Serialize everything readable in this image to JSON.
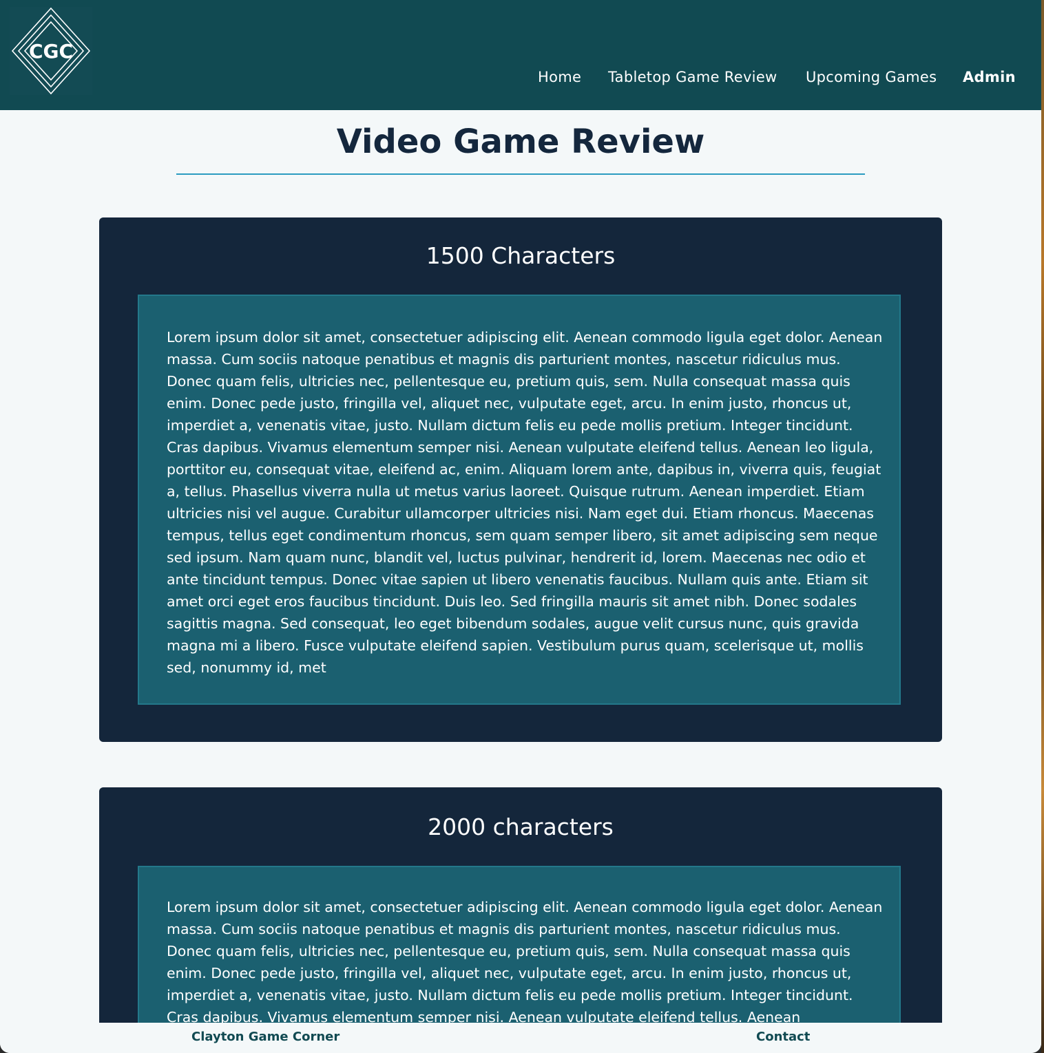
{
  "header": {
    "logo_text": "CGC",
    "nav": {
      "home": "Home",
      "tabletop": "Tabletop Game Review",
      "upcoming": "Upcoming Games",
      "admin": "Admin"
    }
  },
  "page": {
    "title": "Video Game Review"
  },
  "cards": [
    {
      "heading": "1500 Characters",
      "body": "Lorem ipsum dolor sit amet, consectetuer adipiscing elit. Aenean commodo ligula eget dolor. Aenean massa. Cum sociis natoque penatibus et magnis dis parturient montes, nascetur ridiculus mus. Donec quam felis, ultricies nec, pellentesque eu, pretium quis, sem. Nulla consequat massa quis enim. Donec pede justo, fringilla vel, aliquet nec, vulputate eget, arcu. In enim justo, rhoncus ut, imperdiet a, venenatis vitae, justo. Nullam dictum felis eu pede mollis pretium. Integer tincidunt. Cras dapibus. Vivamus elementum semper nisi. Aenean vulputate eleifend tellus. Aenean leo ligula, porttitor eu, consequat vitae, eleifend ac, enim. Aliquam lorem ante, dapibus in, viverra quis, feugiat a, tellus. Phasellus viverra nulla ut metus varius laoreet. Quisque rutrum. Aenean imperdiet. Etiam ultricies nisi vel augue. Curabitur ullamcorper ultricies nisi. Nam eget dui. Etiam rhoncus. Maecenas tempus, tellus eget condimentum rhoncus, sem quam semper libero, sit amet adipiscing sem neque sed ipsum. Nam quam nunc, blandit vel, luctus pulvinar, hendrerit id, lorem. Maecenas nec odio et ante tincidunt tempus. Donec vitae sapien ut libero venenatis faucibus. Nullam quis ante. Etiam sit amet orci eget eros faucibus tincidunt. Duis leo. Sed fringilla mauris sit amet nibh. Donec sodales sagittis magna. Sed consequat, leo eget bibendum sodales, augue velit cursus nunc, quis gravida magna mi a libero. Fusce vulputate eleifend sapien. Vestibulum purus quam, scelerisque ut, mollis sed, nonummy id, met"
    },
    {
      "heading": "2000 characters",
      "body": "Lorem ipsum dolor sit amet, consectetuer adipiscing elit. Aenean commodo ligula eget dolor. Aenean massa. Cum sociis natoque penatibus et magnis dis parturient montes, nascetur ridiculus mus. Donec quam felis, ultricies nec, pellentesque eu, pretium quis, sem. Nulla consequat massa quis enim. Donec pede justo, fringilla vel, aliquet nec, vulputate eget, arcu. In enim justo, rhoncus ut, imperdiet a, venenatis vitae, justo. Nullam dictum felis eu pede mollis pretium. Integer tincidunt. Cras dapibus. Vivamus elementum semper nisi. Aenean vulputate eleifend tellus. Aenean"
    }
  ],
  "footer": {
    "site_name": "Clayton Game Corner",
    "contact": "Contact"
  },
  "colors": {
    "header_bg": "#114a52",
    "page_bg": "#f4f8f9",
    "card_bg": "#14263b",
    "card_body_bg": "#1b6070",
    "title_text": "#14273d",
    "title_rule": "#2a9bc0"
  }
}
